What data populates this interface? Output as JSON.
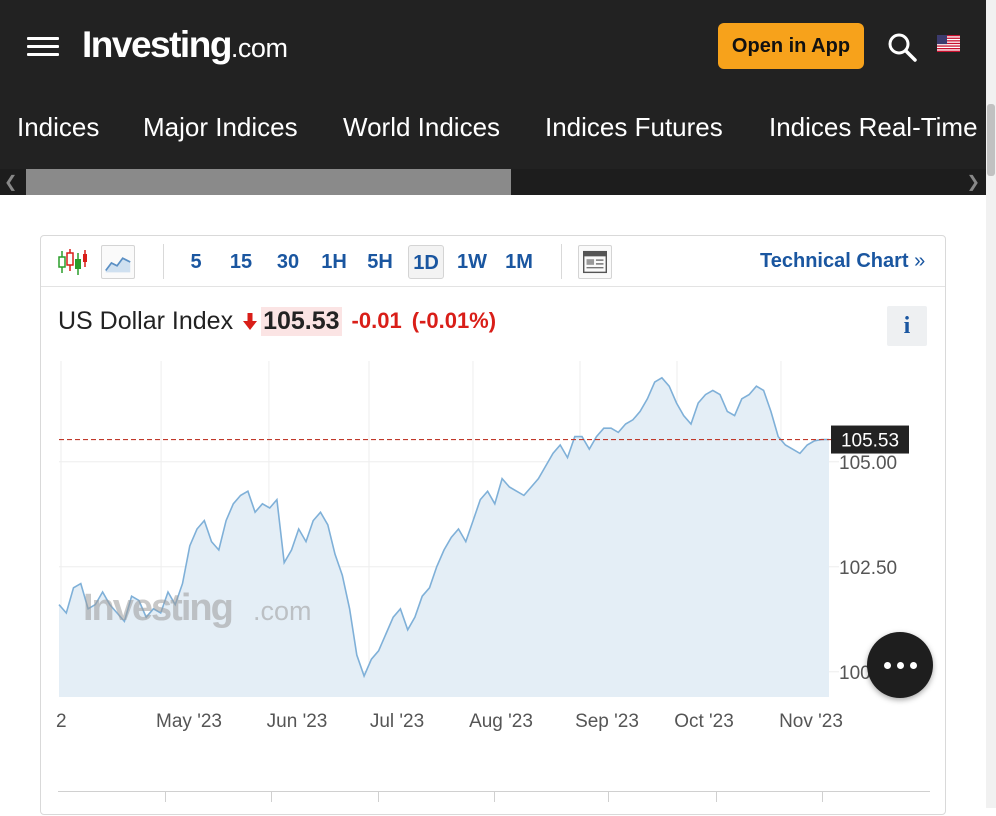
{
  "header": {
    "logo_text": "Investing",
    "logo_suffix": ".com",
    "open_app_label": "Open in App",
    "icons": [
      "hamburger-menu-icon",
      "search-icon",
      "us-flag-icon"
    ]
  },
  "nav": {
    "items": [
      "Indices",
      "Major Indices",
      "World Indices",
      "Indices Futures",
      "Indices Real-Time"
    ]
  },
  "toolbar": {
    "timeframes": [
      "5",
      "15",
      "30",
      "1H",
      "5H",
      "1D",
      "1W",
      "1M"
    ],
    "active_timeframe": "1D",
    "technical_chart_label": "Technical Chart",
    "technical_chart_chevron": "»"
  },
  "quote": {
    "name": "US Dollar Index",
    "price": "105.53",
    "change": "-0.01",
    "change_pct": "(-0.01%)",
    "direction": "down",
    "info_label": "i"
  },
  "colors": {
    "header_bg": "#222222",
    "accent_orange": "#f7a21b",
    "link_blue": "#1a56a0",
    "negative_red": "#d91e18",
    "line_blue": "#7fb0d8",
    "area_fill": "#e4eef6"
  },
  "chart_data": {
    "type": "area",
    "title": "",
    "xlabel": "",
    "ylabel": "",
    "x_tick_labels": [
      "2",
      "May '23",
      "Jun '23",
      "Jul '23",
      "Aug '23",
      "Sep '23",
      "Oct '23",
      "Nov '23"
    ],
    "y_tick_labels": [
      "105.00",
      "102.50",
      "100"
    ],
    "y_ticks": [
      105.0,
      102.5,
      100.0
    ],
    "ylim": [
      99.4,
      107.4
    ],
    "x_range": [
      0,
      212
    ],
    "current_price_label": "105.53",
    "current_price": 105.53,
    "grid": true,
    "watermark": "Investing.com",
    "series": [
      {
        "x": [
          0,
          2,
          4,
          6,
          8,
          10,
          12,
          14,
          16,
          18,
          20,
          22,
          24,
          26,
          28,
          30,
          32,
          34,
          36,
          38,
          40,
          42,
          44,
          46,
          48,
          50,
          52,
          54,
          56,
          58,
          60,
          62,
          64,
          66,
          68,
          70,
          72,
          74,
          76,
          78,
          80,
          82,
          84,
          86,
          88,
          90,
          92,
          94,
          96,
          98,
          100,
          102,
          104,
          106,
          108,
          110,
          112,
          114,
          116,
          118,
          120,
          122,
          124,
          126,
          128,
          130,
          132,
          134,
          136,
          138,
          140,
          142,
          144,
          146,
          148,
          150,
          152,
          154,
          156,
          158,
          160,
          162,
          164,
          166,
          168,
          170,
          172,
          174,
          176,
          178,
          180,
          182,
          184,
          186,
          188,
          190,
          192,
          194,
          196,
          198,
          200,
          202,
          204,
          206,
          208,
          210,
          212
        ],
        "values": [
          101.6,
          101.4,
          102.0,
          102.1,
          101.5,
          101.6,
          101.9,
          101.6,
          101.4,
          101.2,
          101.8,
          101.7,
          101.3,
          101.5,
          101.4,
          101.9,
          101.6,
          102.1,
          103.0,
          103.4,
          103.6,
          103.1,
          102.9,
          103.6,
          104.0,
          104.2,
          104.3,
          103.8,
          104.0,
          103.9,
          104.1,
          102.6,
          102.9,
          103.4,
          103.1,
          103.6,
          103.8,
          103.5,
          102.8,
          102.3,
          101.5,
          100.4,
          99.9,
          100.3,
          100.5,
          100.9,
          101.3,
          101.5,
          101.0,
          101.3,
          101.8,
          102.0,
          102.5,
          102.9,
          103.2,
          103.4,
          103.1,
          103.6,
          104.1,
          104.3,
          104.0,
          104.6,
          104.4,
          104.3,
          104.2,
          104.4,
          104.6,
          104.9,
          105.2,
          105.4,
          105.1,
          105.6,
          105.6,
          105.3,
          105.6,
          105.8,
          105.8,
          105.7,
          105.9,
          106.0,
          106.2,
          106.5,
          106.9,
          107.0,
          106.8,
          106.4,
          106.1,
          105.9,
          106.4,
          106.6,
          106.7,
          106.6,
          106.2,
          106.1,
          106.5,
          106.6,
          106.8,
          106.7,
          106.2,
          105.6,
          105.4,
          105.3,
          105.2,
          105.4,
          105.5,
          105.53,
          105.53
        ]
      }
    ]
  },
  "fab": {
    "icon": "more-dots-icon"
  }
}
